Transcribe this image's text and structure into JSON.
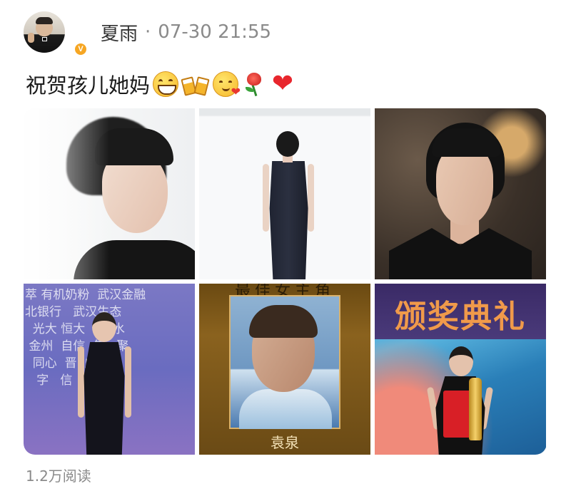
{
  "post": {
    "username": "夏雨",
    "separator": "·",
    "timestamp": "07-30 21:55",
    "verified_badge": "V",
    "text": "祝贺孩儿她妈",
    "emojis": [
      "grinning-face-icon",
      "clinking-beer-mugs-icon",
      "yum-face-with-heart-icon",
      "rose-icon",
      "red-heart-icon"
    ],
    "heart_glyph": "❤"
  },
  "photos": {
    "count": 6,
    "p4_wall_text": "萃 有机奶粉  武汉金融\n北银行   武汉生态\n  光大 恒大  城  水\n 金州  自信  年   聚\n  同心  晋  成  晋\n   字   信   发  ",
    "p5_top_title": "最佳女主角",
    "p5_caption": "袁泉",
    "p6_banner": "颁奖典礼"
  },
  "footer": {
    "read_count": "1.2万阅读"
  },
  "colors": {
    "username": "#333333",
    "meta": "#8a8a8a",
    "badge": "#f6a623"
  }
}
